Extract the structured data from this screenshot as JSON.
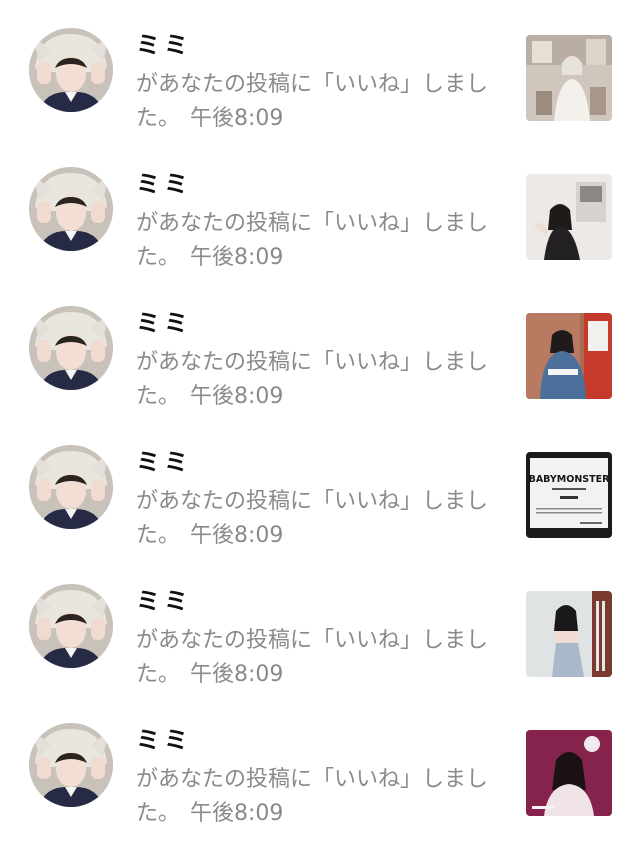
{
  "notifications": [
    {
      "username": "ミミ",
      "message": "があなたの投稿に「いいね」しました。",
      "time": "午後8:09",
      "avatar_icon": "user-avatar-photo",
      "thumbnail_icon": "post-photo-room",
      "thumbnail_text": ""
    },
    {
      "username": "ミミ",
      "message": "があなたの投稿に「いいね」しました。",
      "time": "午後8:09",
      "avatar_icon": "user-avatar-photo",
      "thumbnail_icon": "post-photo-wall",
      "thumbnail_text": ""
    },
    {
      "username": "ミミ",
      "message": "があなたの投稿に「いいね」しました。",
      "time": "午後8:09",
      "avatar_icon": "user-avatar-photo",
      "thumbnail_icon": "post-photo-denim",
      "thumbnail_text": ""
    },
    {
      "username": "ミミ",
      "message": "があなたの投稿に「いいね」しました。",
      "time": "午後8:09",
      "avatar_icon": "user-avatar-photo",
      "thumbnail_icon": "post-invitation-card",
      "thumbnail_text": "BABYMONSTER"
    },
    {
      "username": "ミミ",
      "message": "があなたの投稿に「いいね」しました。",
      "time": "午後8:09",
      "avatar_icon": "user-avatar-photo",
      "thumbnail_icon": "post-photo-studio",
      "thumbnail_text": ""
    },
    {
      "username": "ミミ",
      "message": "があなたの投稿に「いいね」しました。",
      "time": "午後8:09",
      "avatar_icon": "user-avatar-photo",
      "thumbnail_icon": "post-photo-portrait",
      "thumbnail_text": ""
    }
  ],
  "colors": {
    "username": "#111111",
    "message": "#8a8a8a",
    "background": "#ffffff"
  }
}
